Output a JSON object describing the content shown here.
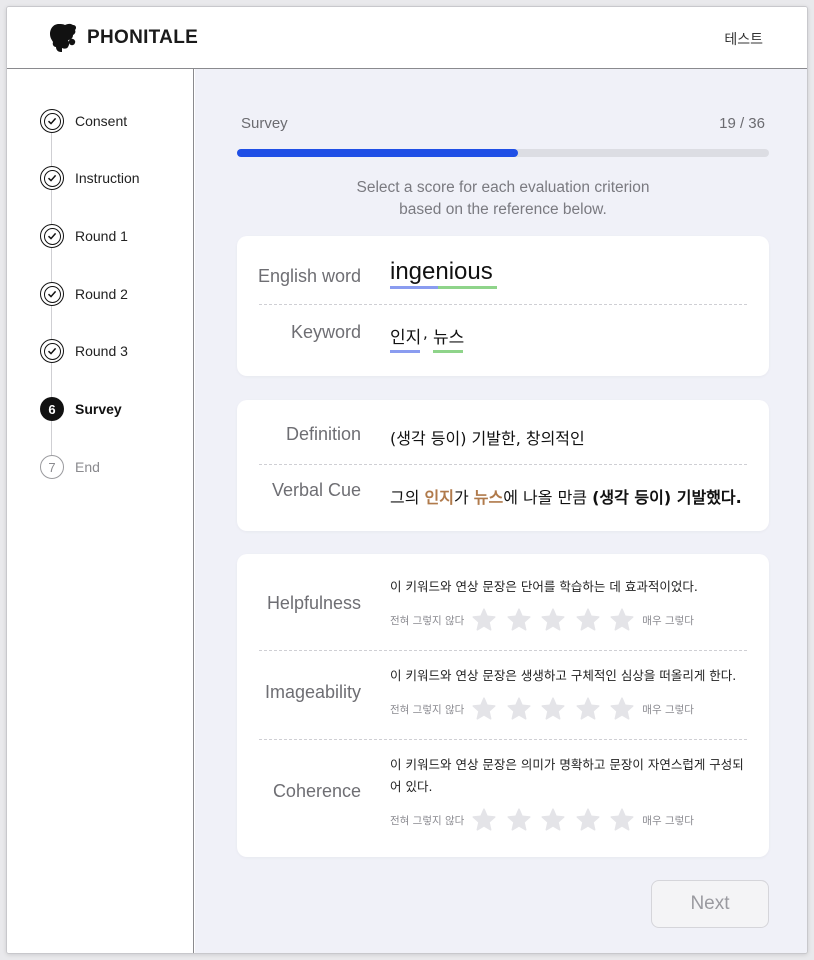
{
  "header": {
    "brand": "PHONITALE",
    "user_name": "테스트"
  },
  "sidebar": {
    "steps": [
      {
        "label": "Consent",
        "status": "done"
      },
      {
        "label": "Instruction",
        "status": "done"
      },
      {
        "label": "Round 1",
        "status": "done"
      },
      {
        "label": "Round 2",
        "status": "done"
      },
      {
        "label": "Round 3",
        "status": "done"
      },
      {
        "label": "Survey",
        "status": "active",
        "number": "6"
      },
      {
        "label": "End",
        "status": "pending",
        "number": "7"
      }
    ]
  },
  "survey": {
    "title": "Survey",
    "counter": "19 / 36",
    "progress_fraction": 0.528,
    "instruction_line1": "Select a score for each evaluation criterion",
    "instruction_line2": "based on the reference below."
  },
  "reference": {
    "english_word_label": "English word",
    "english_word": "ingenious",
    "keyword_label": "Keyword",
    "keywords": [
      "인지",
      "뉴스"
    ],
    "keyword_separator": ",",
    "definition_label": "Definition",
    "definition": "(생각 등이) 기발한, 창의적인",
    "verbal_cue_label": "Verbal Cue",
    "verbal_cue_parts": [
      "그의 ",
      "인지",
      "가 ",
      "뉴스",
      "에 나올 만큼 ",
      "(생각 등이) 기발했다."
    ]
  },
  "criteria": [
    {
      "label": "Helpfulness",
      "question": "이 키워드와 연상 문장은 단어를 학습하는 데 효과적이었다.",
      "low": "전혀 그렇지 않다",
      "high": "매우 그렇다",
      "rating": 0
    },
    {
      "label": "Imageability",
      "question": "이 키워드와 연상 문장은 생생하고 구체적인 심상을 떠올리게 한다.",
      "low": "전혀 그렇지 않다",
      "high": "매우 그렇다",
      "rating": 0
    },
    {
      "label": "Coherence",
      "question": "이 키워드와 연상 문장은 의미가 명확하고 문장이 자연스럽게 구성되어 있다.",
      "low": "전혀 그렇지 않다",
      "high": "매우 그렇다",
      "rating": 0
    }
  ],
  "next_button": "Next",
  "colors": {
    "accent": "#1f4fe6",
    "keyword1_underline": "#8a9cf0",
    "keyword2_underline": "#8fd48a",
    "cue_highlight": "#b07a4b",
    "star_empty": "#e4e4e8"
  }
}
